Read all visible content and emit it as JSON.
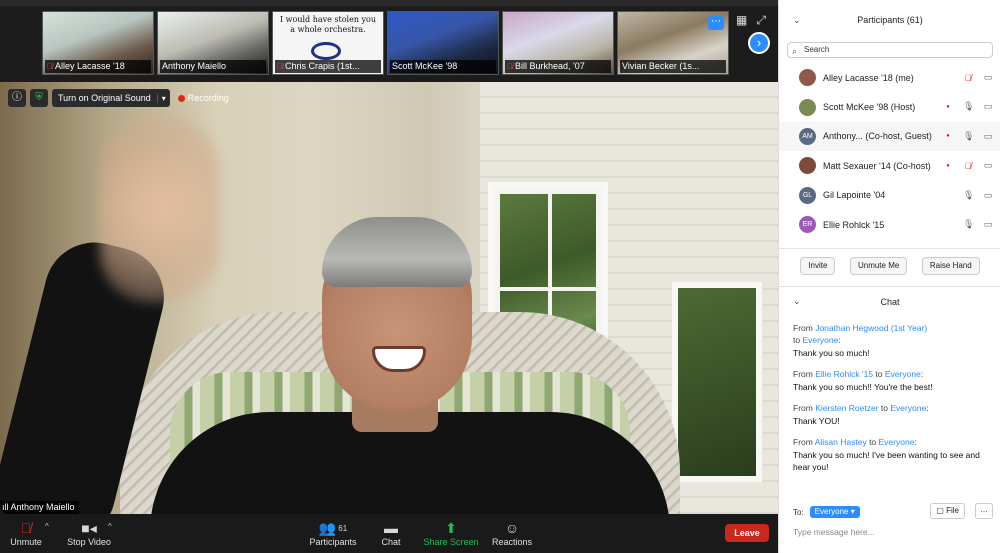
{
  "gallery": {
    "thumbnails": [
      {
        "name": "Alley Lacasse '18",
        "muted": true
      },
      {
        "name": "Anthony Maiello",
        "muted": false
      },
      {
        "name": "Chris Crapis (1st...",
        "muted": true,
        "quote": "I would have stolen you a whole orchestra."
      },
      {
        "name": "Scott McKee '98",
        "muted": false
      },
      {
        "name": "Bill Burkhead, '07",
        "muted": true
      },
      {
        "name": "Vivian Becker (1s...",
        "muted": false
      }
    ]
  },
  "main_video": {
    "speaker_name": "Anthony Maiello",
    "original_sound_label": "Turn on Original Sound",
    "recording_label": "Recording"
  },
  "toolbar": {
    "unmute_label": "Unmute",
    "stop_video_label": "Stop Video",
    "participants_label": "Participants",
    "participants_count": "61",
    "chat_label": "Chat",
    "share_screen_label": "Share Screen",
    "reactions_label": "Reactions",
    "leave_label": "Leave"
  },
  "participants_panel": {
    "title": "Participants (61)",
    "search_placeholder": "Search",
    "list": [
      {
        "name": "Alley Lacasse '18 (me)",
        "initials": "",
        "avatar_color": "#8b5a4a",
        "video_off": false,
        "mic": "muted",
        "rec": false
      },
      {
        "name": "Scott McKee '98 (Host)",
        "initials": "",
        "avatar_color": "#7a8a55",
        "video_off": false,
        "mic": "on",
        "rec": true
      },
      {
        "name": "Anthony...  (Co-host, Guest)",
        "initials": "AM",
        "avatar_color": "#5a6a80",
        "video_off": false,
        "mic": "on",
        "rec": true
      },
      {
        "name": "Matt Sexauer '14 (Co-host)",
        "initials": "",
        "avatar_color": "#7b4a3a",
        "video_off": false,
        "mic": "muted",
        "rec": true
      },
      {
        "name": "Gil Lapointe '04",
        "initials": "GL",
        "avatar_color": "#5a6a80",
        "video_off": false,
        "mic": "on",
        "rec": false
      },
      {
        "name": "Ellie Rohlck '15",
        "initials": "ER",
        "avatar_color": "#9b5ab5",
        "video_off": false,
        "mic": "on",
        "rec": false
      }
    ],
    "buttons": {
      "invite": "Invite",
      "unmute_me": "Unmute Me",
      "raise_hand": "Raise Hand"
    }
  },
  "chat_panel": {
    "title": "Chat",
    "messages": [
      {
        "from_prefix": "From ",
        "sender": "Jonathan Hegwood (1st Year)",
        "to_prefix": "to ",
        "recipient": "Everyone",
        "to_suffix": ":",
        "text": "Thank you so much!",
        "inline": false
      },
      {
        "from_prefix": "From ",
        "sender": "Ellie Rohlck '15",
        "to_prefix": " to ",
        "recipient": "Everyone",
        "to_suffix": ":",
        "text": "Thank you so much!! You're the best!",
        "inline": true
      },
      {
        "from_prefix": "From ",
        "sender": "Kiersten Roetzer",
        "to_prefix": " to ",
        "recipient": "Everyone",
        "to_suffix": ":",
        "text": "Thank YOU!",
        "inline": true
      },
      {
        "from_prefix": "From ",
        "sender": "Alisan Hastey",
        "to_prefix": " to ",
        "recipient": "Everyone",
        "to_suffix": ":",
        "text": "Thank you so much!  I've been wanting to see and hear you!",
        "inline": true
      }
    ],
    "to_label": "To:",
    "recipient_select": "Everyone",
    "file_label": "File",
    "more_label": "…",
    "input_placeholder": "Type message here..."
  },
  "colors": {
    "accent_blue": "#2d8cff",
    "leave_red": "#c8291c",
    "share_green": "#1cbf5a",
    "muted_red": "#e0261b"
  }
}
